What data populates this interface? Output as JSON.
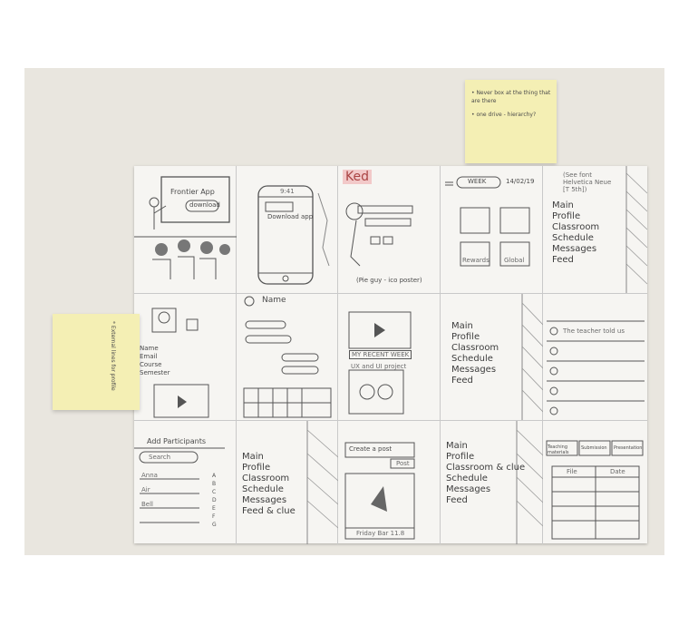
{
  "sticky_notes": {
    "top_right": {
      "lines": [
        "• Never box at the thing that are there",
        "• one drive - hierarchy?"
      ]
    },
    "left": {
      "text": "* External lines for profile"
    }
  },
  "sketches": {
    "intro_projector": {
      "screen_title": "Frontier App",
      "screen_button": "download"
    },
    "phone_download": {
      "top_bar": "9:41",
      "button": "Download app"
    },
    "logo_panel": {
      "logo": "Ked"
    },
    "app_start_note": {
      "caption": "(Pie guy - ico poster)"
    },
    "dashboard": {
      "week_button": "WEEK",
      "date": "14/02/19",
      "tiles": [
        "Rewards",
        "Global"
      ]
    },
    "side_menu_a": {
      "header": "(See font Helvetica Neue [T 5th])",
      "items": [
        "Main",
        "Profile",
        "Classroom",
        "Schedule",
        "Messages",
        "Feed"
      ]
    },
    "profile_card": {
      "fields": [
        "Name",
        "Email",
        "Course",
        "Semester"
      ]
    },
    "form_screen": {
      "title": "Name"
    },
    "recent_week": {
      "banner": "MY RECENT WEEK",
      "caption": "UX and UI project"
    },
    "side_menu_b": {
      "items": [
        "Main",
        "Profile",
        "Classroom",
        "Schedule",
        "Messages",
        "Feed"
      ]
    },
    "notifications": {
      "row": "The teacher told us"
    },
    "add_participants": {
      "title": "Add Participants",
      "search": "Search",
      "names": [
        "Anna",
        "Air",
        "Bell"
      ],
      "letters": [
        "A",
        "B",
        "C",
        "D",
        "E",
        "F",
        "G"
      ]
    },
    "side_menu_c": {
      "items": [
        "Main",
        "Profile",
        "Classroom",
        "Schedule",
        "Messages",
        "Feed & clue"
      ]
    },
    "create_post": {
      "title": "Create a post",
      "button": "Post",
      "footer": "Friday Bar 11.8"
    },
    "side_menu_d": {
      "items": [
        "Main",
        "Profile",
        "Classroom & clue",
        "Schedule",
        "Messages",
        "Feed"
      ]
    },
    "files": {
      "tabs": [
        "Teaching materials",
        "Submission",
        "Presentation"
      ],
      "cols": [
        "File",
        "Date"
      ]
    }
  },
  "colors": {
    "paper": "#f6f5f2",
    "wall": "#e9e6df",
    "sticky": "#f4efb4",
    "pencil": "#4a4a4a",
    "logo_red": "#d98a8a"
  }
}
